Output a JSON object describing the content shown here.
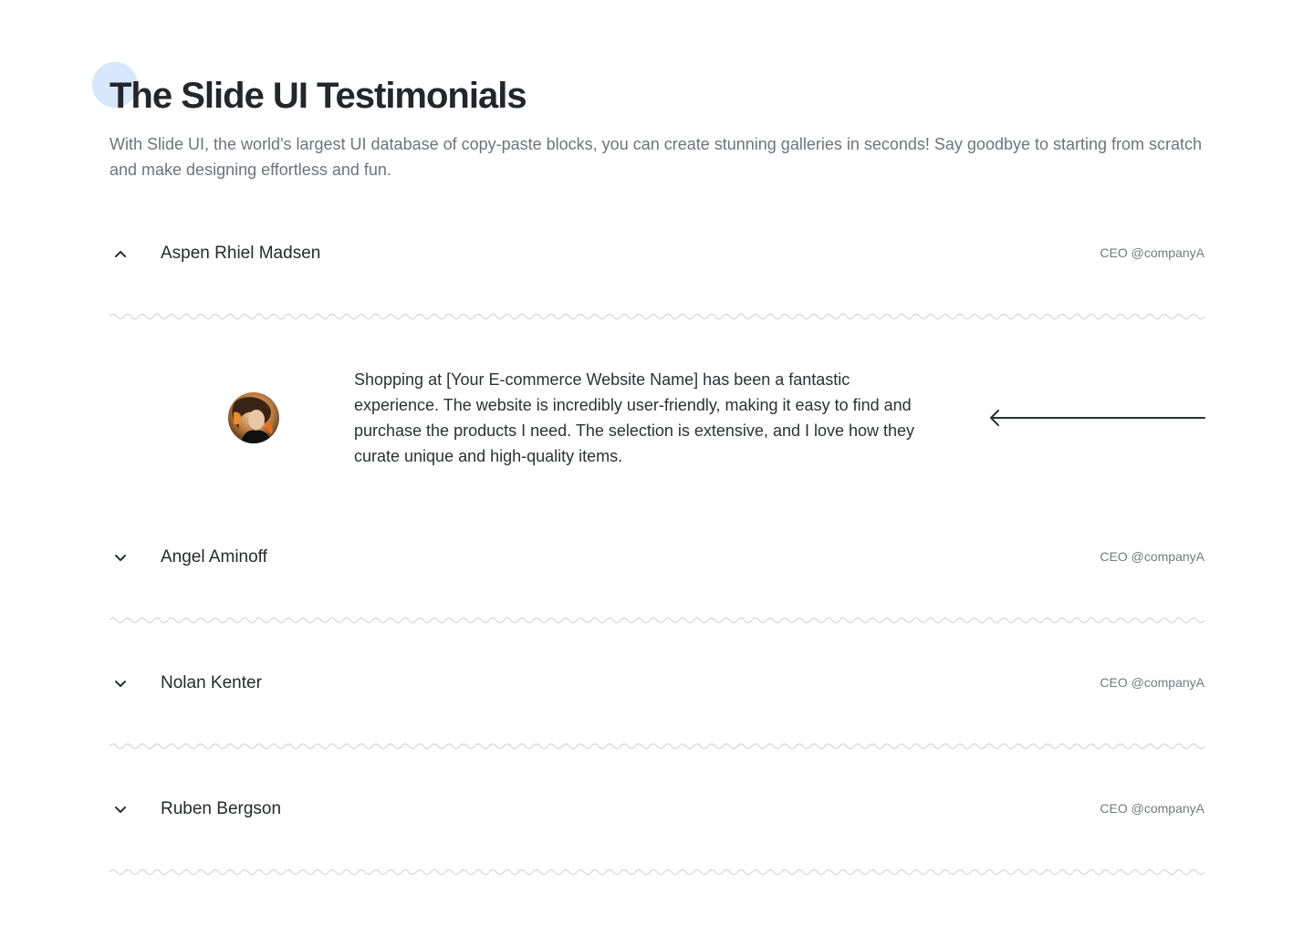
{
  "header": {
    "title": "The Slide UI Testimonials",
    "subtitle": "With Slide UI, the world's largest UI database of copy-paste blocks, you can create stunning galleries in seconds! Say goodbye to starting from scratch and make designing effortless and fun."
  },
  "testimonials": [
    {
      "name": "Aspen Rhiel Madsen",
      "role": "CEO @companyA",
      "expanded": true,
      "chevron_icon": "chevron-up-icon",
      "quote": "Shopping at [Your E-commerce Website Name] has been a fantastic experience. The website is incredibly user-friendly, making it easy to find and purchase the products I need. The selection is extensive, and I love how they curate unique and high-quality items.",
      "avatar": "avatar-photo",
      "nav_icon": "arrow-left-icon"
    },
    {
      "name": "Angel Aminoff",
      "role": "CEO @companyA",
      "expanded": false,
      "chevron_icon": "chevron-down-icon"
    },
    {
      "name": "Nolan Kenter",
      "role": "CEO @companyA",
      "expanded": false,
      "chevron_icon": "chevron-down-icon"
    },
    {
      "name": "Ruben Bergson",
      "role": "CEO @companyA",
      "expanded": false,
      "chevron_icon": "chevron-down-icon"
    }
  ],
  "colors": {
    "accent_circle": "#d7e7fb",
    "divider": "#c9cccf",
    "text_dark": "#23272b",
    "text_muted": "#6e747a"
  }
}
